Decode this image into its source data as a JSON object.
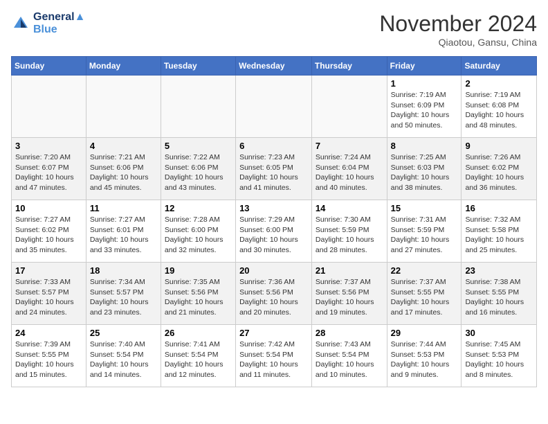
{
  "header": {
    "logo_line1": "General",
    "logo_line2": "Blue",
    "month": "November 2024",
    "location": "Qiaotou, Gansu, China"
  },
  "weekdays": [
    "Sunday",
    "Monday",
    "Tuesday",
    "Wednesday",
    "Thursday",
    "Friday",
    "Saturday"
  ],
  "weeks": [
    [
      {
        "day": "",
        "info": ""
      },
      {
        "day": "",
        "info": ""
      },
      {
        "day": "",
        "info": ""
      },
      {
        "day": "",
        "info": ""
      },
      {
        "day": "",
        "info": ""
      },
      {
        "day": "1",
        "info": "Sunrise: 7:19 AM\nSunset: 6:09 PM\nDaylight: 10 hours\nand 50 minutes."
      },
      {
        "day": "2",
        "info": "Sunrise: 7:19 AM\nSunset: 6:08 PM\nDaylight: 10 hours\nand 48 minutes."
      }
    ],
    [
      {
        "day": "3",
        "info": "Sunrise: 7:20 AM\nSunset: 6:07 PM\nDaylight: 10 hours\nand 47 minutes."
      },
      {
        "day": "4",
        "info": "Sunrise: 7:21 AM\nSunset: 6:06 PM\nDaylight: 10 hours\nand 45 minutes."
      },
      {
        "day": "5",
        "info": "Sunrise: 7:22 AM\nSunset: 6:06 PM\nDaylight: 10 hours\nand 43 minutes."
      },
      {
        "day": "6",
        "info": "Sunrise: 7:23 AM\nSunset: 6:05 PM\nDaylight: 10 hours\nand 41 minutes."
      },
      {
        "day": "7",
        "info": "Sunrise: 7:24 AM\nSunset: 6:04 PM\nDaylight: 10 hours\nand 40 minutes."
      },
      {
        "day": "8",
        "info": "Sunrise: 7:25 AM\nSunset: 6:03 PM\nDaylight: 10 hours\nand 38 minutes."
      },
      {
        "day": "9",
        "info": "Sunrise: 7:26 AM\nSunset: 6:02 PM\nDaylight: 10 hours\nand 36 minutes."
      }
    ],
    [
      {
        "day": "10",
        "info": "Sunrise: 7:27 AM\nSunset: 6:02 PM\nDaylight: 10 hours\nand 35 minutes."
      },
      {
        "day": "11",
        "info": "Sunrise: 7:27 AM\nSunset: 6:01 PM\nDaylight: 10 hours\nand 33 minutes."
      },
      {
        "day": "12",
        "info": "Sunrise: 7:28 AM\nSunset: 6:00 PM\nDaylight: 10 hours\nand 32 minutes."
      },
      {
        "day": "13",
        "info": "Sunrise: 7:29 AM\nSunset: 6:00 PM\nDaylight: 10 hours\nand 30 minutes."
      },
      {
        "day": "14",
        "info": "Sunrise: 7:30 AM\nSunset: 5:59 PM\nDaylight: 10 hours\nand 28 minutes."
      },
      {
        "day": "15",
        "info": "Sunrise: 7:31 AM\nSunset: 5:59 PM\nDaylight: 10 hours\nand 27 minutes."
      },
      {
        "day": "16",
        "info": "Sunrise: 7:32 AM\nSunset: 5:58 PM\nDaylight: 10 hours\nand 25 minutes."
      }
    ],
    [
      {
        "day": "17",
        "info": "Sunrise: 7:33 AM\nSunset: 5:57 PM\nDaylight: 10 hours\nand 24 minutes."
      },
      {
        "day": "18",
        "info": "Sunrise: 7:34 AM\nSunset: 5:57 PM\nDaylight: 10 hours\nand 23 minutes."
      },
      {
        "day": "19",
        "info": "Sunrise: 7:35 AM\nSunset: 5:56 PM\nDaylight: 10 hours\nand 21 minutes."
      },
      {
        "day": "20",
        "info": "Sunrise: 7:36 AM\nSunset: 5:56 PM\nDaylight: 10 hours\nand 20 minutes."
      },
      {
        "day": "21",
        "info": "Sunrise: 7:37 AM\nSunset: 5:56 PM\nDaylight: 10 hours\nand 19 minutes."
      },
      {
        "day": "22",
        "info": "Sunrise: 7:37 AM\nSunset: 5:55 PM\nDaylight: 10 hours\nand 17 minutes."
      },
      {
        "day": "23",
        "info": "Sunrise: 7:38 AM\nSunset: 5:55 PM\nDaylight: 10 hours\nand 16 minutes."
      }
    ],
    [
      {
        "day": "24",
        "info": "Sunrise: 7:39 AM\nSunset: 5:55 PM\nDaylight: 10 hours\nand 15 minutes."
      },
      {
        "day": "25",
        "info": "Sunrise: 7:40 AM\nSunset: 5:54 PM\nDaylight: 10 hours\nand 14 minutes."
      },
      {
        "day": "26",
        "info": "Sunrise: 7:41 AM\nSunset: 5:54 PM\nDaylight: 10 hours\nand 12 minutes."
      },
      {
        "day": "27",
        "info": "Sunrise: 7:42 AM\nSunset: 5:54 PM\nDaylight: 10 hours\nand 11 minutes."
      },
      {
        "day": "28",
        "info": "Sunrise: 7:43 AM\nSunset: 5:54 PM\nDaylight: 10 hours\nand 10 minutes."
      },
      {
        "day": "29",
        "info": "Sunrise: 7:44 AM\nSunset: 5:53 PM\nDaylight: 10 hours\nand 9 minutes."
      },
      {
        "day": "30",
        "info": "Sunrise: 7:45 AM\nSunset: 5:53 PM\nDaylight: 10 hours\nand 8 minutes."
      }
    ]
  ]
}
